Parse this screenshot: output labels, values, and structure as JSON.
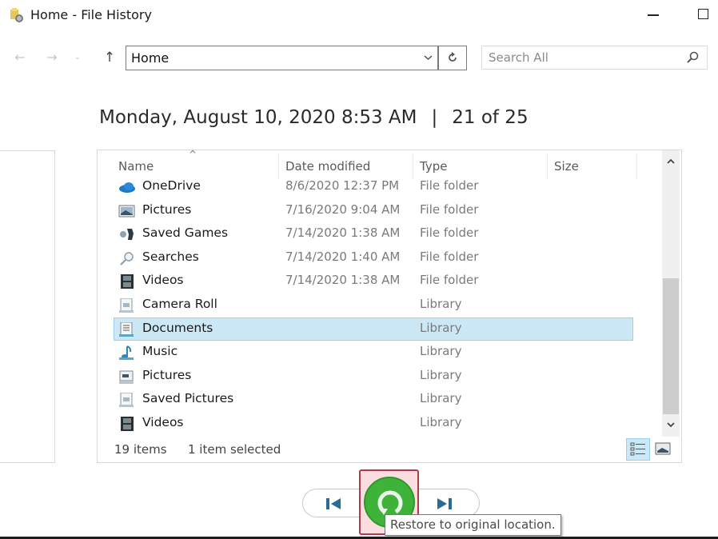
{
  "window": {
    "title": "Home - File History",
    "app_icon": "file-history-icon",
    "controls": [
      "minimize",
      "maximize"
    ]
  },
  "nav": {
    "back_icon": "arrow-left-icon",
    "forward_icon": "arrow-right-icon",
    "recent_icon": "chevron-down-icon",
    "up_icon": "arrow-up-icon",
    "address_value": "Home",
    "refresh_icon": "refresh-icon",
    "search_placeholder": "Search All",
    "search_icon": "search-icon"
  },
  "snapshot": {
    "datetime": "Monday, August 10, 2020 8:53 AM",
    "separator": "|",
    "position": "21 of 25"
  },
  "file_list": {
    "sort_indicator": "^",
    "columns": [
      "Name",
      "Date modified",
      "Type",
      "Size"
    ],
    "rows": [
      {
        "name": "OneDrive",
        "date": "8/6/2020 12:37 PM",
        "type": "File folder",
        "size": "",
        "icon": "onedrive-icon",
        "selected": false
      },
      {
        "name": "Pictures",
        "date": "7/16/2020 9:04 AM",
        "type": "File folder",
        "size": "",
        "icon": "pictures-icon",
        "selected": false
      },
      {
        "name": "Saved Games",
        "date": "7/14/2020 1:38 AM",
        "type": "File folder",
        "size": "",
        "icon": "saved-games-icon",
        "selected": false
      },
      {
        "name": "Searches",
        "date": "7/14/2020 1:40 AM",
        "type": "File folder",
        "size": "",
        "icon": "searches-icon",
        "selected": false
      },
      {
        "name": "Videos",
        "date": "7/14/2020 1:38 AM",
        "type": "File folder",
        "size": "",
        "icon": "videos-icon",
        "selected": false
      },
      {
        "name": "Camera Roll",
        "date": "",
        "type": "Library",
        "size": "",
        "icon": "library-icon",
        "selected": false
      },
      {
        "name": "Documents",
        "date": "",
        "type": "Library",
        "size": "",
        "icon": "documents-library-icon",
        "selected": true
      },
      {
        "name": "Music",
        "date": "",
        "type": "Library",
        "size": "",
        "icon": "music-library-icon",
        "selected": false
      },
      {
        "name": "Pictures",
        "date": "",
        "type": "Library",
        "size": "",
        "icon": "pictures-library-icon",
        "selected": false
      },
      {
        "name": "Saved Pictures",
        "date": "",
        "type": "Library",
        "size": "",
        "icon": "library-icon",
        "selected": false
      },
      {
        "name": "Videos",
        "date": "",
        "type": "Library",
        "size": "",
        "icon": "videos-library-icon",
        "selected": false
      }
    ],
    "scroll_position_fraction": 0.85
  },
  "status": {
    "item_count": "19 items",
    "selection": "1 item selected",
    "view_details_icon": "details-view-icon",
    "view_large_icon": "large-icons-view-icon"
  },
  "controls": {
    "previous_icon": "previous-version-icon",
    "restore_icon": "restore-icon",
    "next_icon": "next-version-icon",
    "tooltip": "Restore to original location."
  },
  "colors": {
    "selection_bg": "#cce8f6",
    "selection_border": "#99d1ef",
    "restore_green": "#3fb23a",
    "focus_red": "#b23a48",
    "nav_icon_blue": "#2b6a96"
  }
}
